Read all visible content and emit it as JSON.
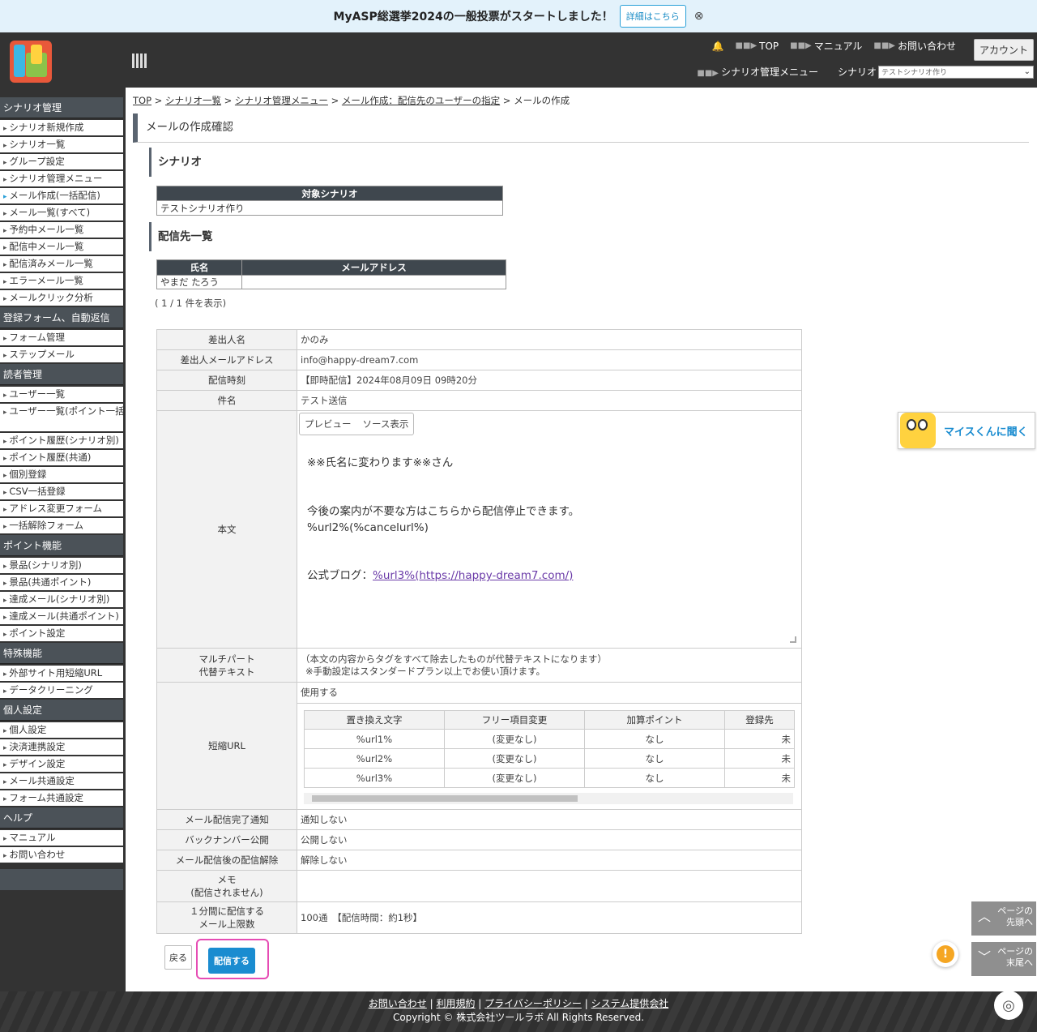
{
  "banner": {
    "text": "MyASP総選挙2024の一般投票がスタートしました！",
    "button": "詳細はこちら",
    "close": "⊗"
  },
  "header": {
    "nav": [
      "TOP",
      "マニュアル",
      "お問い合わせ"
    ],
    "account": "アカウント",
    "scenario_menu": "シナリオ管理メニュー",
    "scenario_label": "シナリオ",
    "scenario_value": "テストシナリオ作り"
  },
  "sidebar": {
    "sections": [
      {
        "title": "シナリオ管理",
        "items": [
          "シナリオ新規作成",
          "シナリオ一覧",
          "グループ設定",
          "シナリオ管理メニュー",
          "メール作成(一括配信)",
          "メール一覧(すべて)",
          "予約中メール一覧",
          "配信中メール一覧",
          "配信済みメール一覧",
          "エラーメール一覧",
          "メールクリック分析"
        ]
      },
      {
        "title": "登録フォーム、自動返信",
        "items": [
          "フォーム管理",
          "ステップメール"
        ]
      },
      {
        "title": "読者管理",
        "items": [
          "ユーザー一覧",
          "ユーザー一覧(ポイント一括操作)",
          "ポイント履歴(シナリオ別)",
          "ポイント履歴(共通)",
          "個別登録",
          "CSV一括登録",
          "アドレス変更フォーム",
          "一括解除フォーム"
        ]
      },
      {
        "title": "ポイント機能",
        "items": [
          "景品(シナリオ別)",
          "景品(共通ポイント)",
          "達成メール(シナリオ別)",
          "達成メール(共通ポイント)",
          "ポイント設定"
        ]
      },
      {
        "title": "特殊機能",
        "items": [
          "外部サイト用短縮URL",
          "データクリーニング"
        ]
      },
      {
        "title": "個人設定",
        "items": [
          "個人設定",
          "決済連携設定",
          "デザイン設定",
          "メール共通設定",
          "フォーム共通設定"
        ]
      },
      {
        "title": "ヘルプ",
        "items": [
          "マニュアル",
          "お問い合わせ"
        ]
      }
    ]
  },
  "breadcrumb": {
    "items": [
      "TOP",
      "シナリオ一覧",
      "シナリオ管理メニュー",
      "メール作成：配信先のユーザーの指定"
    ],
    "current": "メールの作成"
  },
  "page_title": "メールの作成確認",
  "scenario": {
    "heading": "シナリオ",
    "col": "対象シナリオ",
    "value": "テストシナリオ作り"
  },
  "dest": {
    "heading": "配信先一覧",
    "col_name": "氏名",
    "col_email": "メールアドレス",
    "name": "やまだ たろう",
    "count": "( 1 / 1 件を表示)"
  },
  "form": {
    "sender_name_label": "差出人名",
    "sender_name": "かのみ",
    "sender_email_label": "差出人メールアドレス",
    "sender_email": "info@happy-dream7.com",
    "time_label": "配信時刻",
    "time": "【即時配信】2024年08月09日 09時20分",
    "subject_label": "件名",
    "subject": "テスト送信",
    "body_label": "本文",
    "tab_preview": "プレビュー",
    "tab_source": "ソース表示",
    "body_line1": "※※氏名に変わります※※さん",
    "body_line2": "今後の案内が不要な方はこちらから配信停止できます。",
    "body_line3": "%url2%(%cancelurl%)",
    "body_line4_prefix": "公式ブログ：",
    "body_line4_link": "%url3%(https://happy-dream7.com/)",
    "multipart_label_1": "マルチパート",
    "multipart_label_2": "代替テキスト",
    "multipart_1": "（本文の内容からタグをすべて除去したものが代替テキストになります）",
    "multipart_2": "※手動設定はスタンダードプラン以上でお使い頂けます。",
    "short_label": "短縮URL",
    "short_use": "使用する",
    "short_cols": [
      "置き換え文字",
      "フリー項目変更",
      "加算ポイント",
      "登録先"
    ],
    "short_rows": [
      [
        "%url1%",
        "(変更なし)",
        "なし",
        "未"
      ],
      [
        "%url2%",
        "(変更なし)",
        "なし",
        "未"
      ],
      [
        "%url3%",
        "(変更なし)",
        "なし",
        "未"
      ]
    ],
    "notify_label": "メール配信完了通知",
    "notify": "通知しない",
    "backnum_label": "バックナンバー公開",
    "backnum": "公開しない",
    "unsub_label": "メール配信後の配信解除",
    "unsub": "解除しない",
    "memo_label_1": "メモ",
    "memo_label_2": "(配信されません)",
    "memo": "",
    "limit_label_1": "１分間に配信する",
    "limit_label_2": "メール上限数",
    "limit": "100通　【配信時間：約1秒】"
  },
  "buttons": {
    "back": "戻る",
    "send": "配信する"
  },
  "ask": "マイスくんに聞く",
  "page_top": [
    "ページの",
    "先頭へ"
  ],
  "page_end": [
    "ページの",
    "末尾へ"
  ],
  "footer": {
    "links": [
      "お問い合わせ",
      "利用規約",
      "プライバシーポリシー",
      "システム提供会社"
    ],
    "copyright": "Copyright © 株式会社ツールラボ All Rights Reserved."
  }
}
